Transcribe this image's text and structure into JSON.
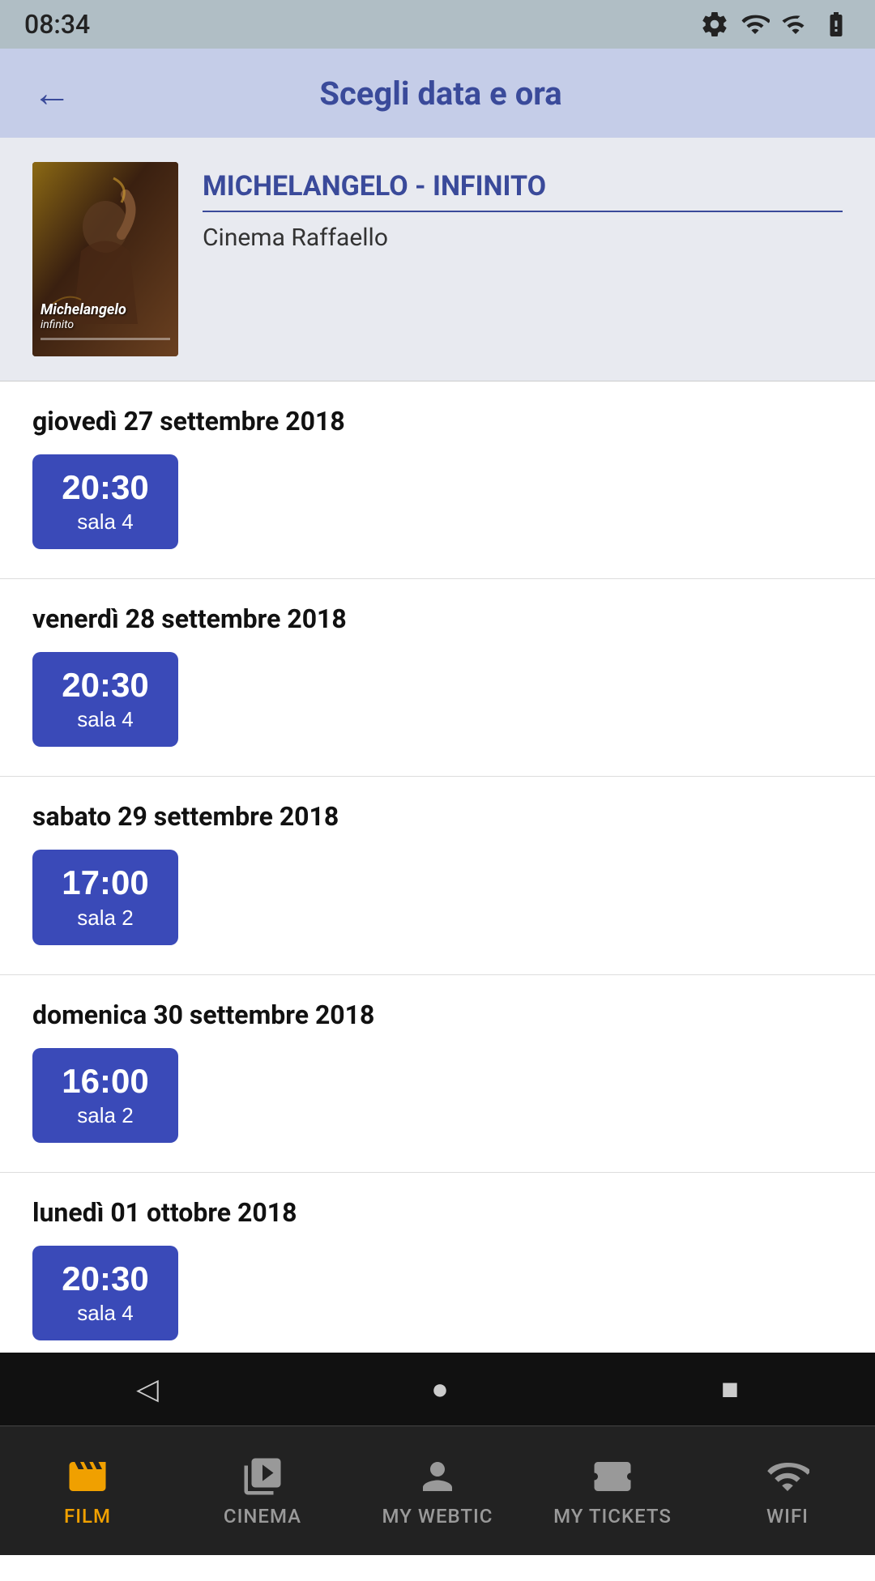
{
  "statusBar": {
    "time": "08:34",
    "gearIcon": "gear",
    "wifiIcon": "wifi",
    "signalIcon": "signal",
    "batteryIcon": "battery"
  },
  "header": {
    "backLabel": "←",
    "title": "Scegli data e ora"
  },
  "movie": {
    "title": "MICHELANGELO - INFINITO",
    "cinema": "Cinema Raffaello",
    "posterText": "Michelangelo",
    "posterSubText": "infinito"
  },
  "schedule": [
    {
      "dayLabel": "giovedì 27 settembre 2018",
      "showtimes": [
        {
          "time": "20:30",
          "sala": "sala 4"
        }
      ]
    },
    {
      "dayLabel": "venerdì 28 settembre 2018",
      "showtimes": [
        {
          "time": "20:30",
          "sala": "sala 4"
        }
      ]
    },
    {
      "dayLabel": "sabato 29 settembre 2018",
      "showtimes": [
        {
          "time": "17:00",
          "sala": "sala 2"
        }
      ]
    },
    {
      "dayLabel": "domenica 30 settembre 2018",
      "showtimes": [
        {
          "time": "16:00",
          "sala": "sala 2"
        }
      ]
    },
    {
      "dayLabel": "lunedì 01 ottobre 2018",
      "showtimes": [
        {
          "time": "20:30",
          "sala": "sala 4"
        }
      ]
    }
  ],
  "bottomNav": {
    "items": [
      {
        "id": "film",
        "label": "FILM",
        "active": true
      },
      {
        "id": "cinema",
        "label": "CINEMA",
        "active": false
      },
      {
        "id": "mywebtic",
        "label": "MY WEBTIC",
        "active": false
      },
      {
        "id": "mytickets",
        "label": "MY TICKETS",
        "active": false
      },
      {
        "id": "wifi",
        "label": "WIFI",
        "active": false
      }
    ]
  },
  "androidNav": {
    "back": "◁",
    "home": "●",
    "recent": "■"
  }
}
